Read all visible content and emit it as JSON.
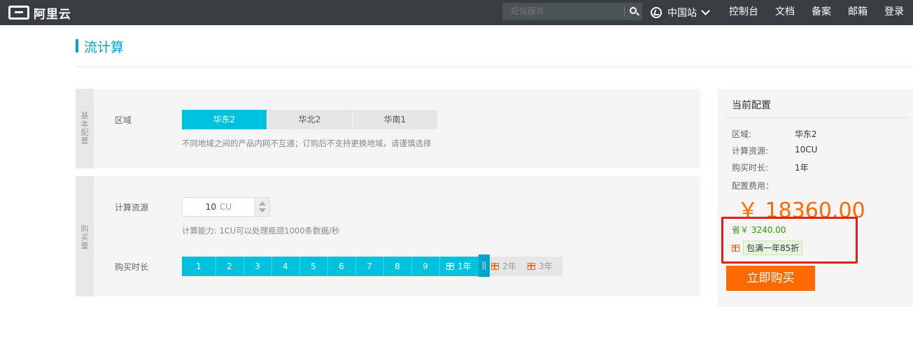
{
  "header": {
    "logo_text": "阿里云",
    "search_placeholder": "短信服务",
    "region_label": "中国站",
    "nav": [
      "控制台",
      "文档",
      "备案",
      "邮箱",
      "登录"
    ]
  },
  "page": {
    "title": "流计算"
  },
  "basic": {
    "side_label": [
      "基",
      "本",
      "配",
      "置"
    ],
    "region_label": "区域",
    "regions": [
      "华东2",
      "华北2",
      "华南1"
    ],
    "selected_region": "华东2",
    "hint": "不同地域之间的产品内网不互通；订购后不支持更换地域，请谨慎选择"
  },
  "purchase": {
    "side_label": [
      "购",
      "买",
      "量"
    ],
    "compute_label": "计算资源",
    "compute_value": "10",
    "compute_unit": "CU",
    "compute_hint": "计算能力: 1CU可以处理瓶颈1000条数据/秒",
    "duration_label": "购买时长",
    "durations": [
      "1",
      "2",
      "3",
      "4",
      "5",
      "6",
      "7",
      "8",
      "9",
      "1年",
      "2年",
      "3年"
    ],
    "selected_duration": "1年"
  },
  "summary": {
    "title": "当前配置",
    "rows": [
      {
        "k": "区域:",
        "v": "华东2"
      },
      {
        "k": "计算资源:",
        "v": "10CU"
      },
      {
        "k": "购买时长:",
        "v": "1年"
      }
    ],
    "fee_label": "配置费用：",
    "price": "￥ 18360.00",
    "save": "省￥ 3240.00",
    "promo": "包满一年85折",
    "buy_label": "立即购买"
  },
  "colors": {
    "accent": "#00c1de",
    "orange": "#ff6a00",
    "topbar": "#373d41"
  }
}
